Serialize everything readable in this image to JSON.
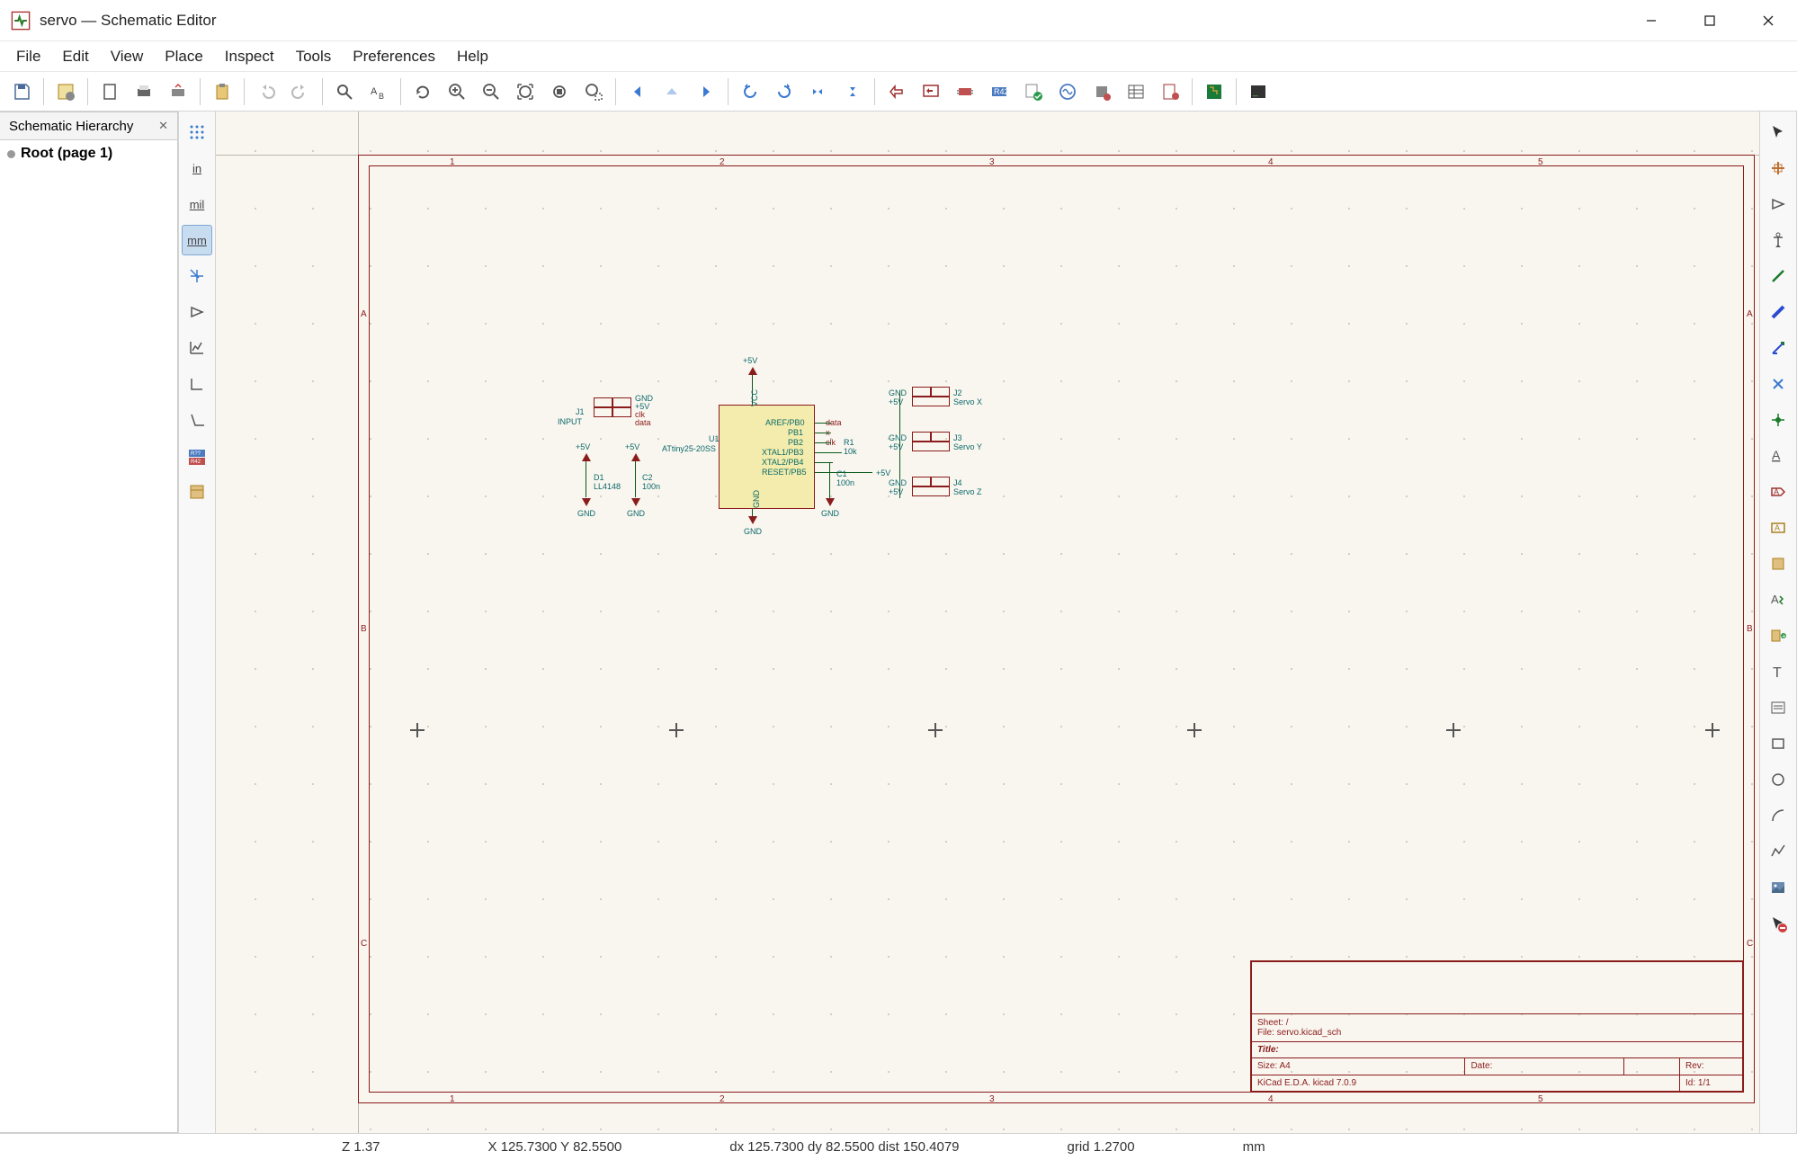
{
  "title": "servo — Schematic Editor",
  "menu": [
    "File",
    "Edit",
    "View",
    "Place",
    "Inspect",
    "Tools",
    "Preferences",
    "Help"
  ],
  "hierarchy": {
    "tab": "Schematic Hierarchy",
    "root": "Root (page 1)"
  },
  "left_icons": [
    "grid-icon",
    "in",
    "mil",
    "mm",
    "cursor-cross",
    "opamp-icon",
    "plot-icon",
    "axes-icon",
    "skew-axes-icon",
    "ref-r42-icon",
    "sheet-icon"
  ],
  "left_active_index": 3,
  "right_icons": [
    "select-icon",
    "highlight-net-icon",
    "opamp-place-icon",
    "power-port-icon",
    "wire-icon",
    "bus-icon",
    "bus-entry-icon",
    "noconnect-icon",
    "junction-icon",
    "local-label-icon",
    "global-label-icon",
    "hier-label-icon",
    "sheet-icon",
    "netclass-icon",
    "sheet-pin-icon",
    "text-letter-icon",
    "textbox-icon",
    "rect-icon",
    "circle-icon",
    "arc-icon",
    "polyline-icon",
    "image-icon",
    "delete-tool-icon"
  ],
  "schematic": {
    "power_labels": {
      "p5v": "+5V",
      "gnd": "GND"
    },
    "connectors": [
      {
        "ref": "J1",
        "name": "INPUT",
        "pins": [
          "GND",
          "+5V",
          "clk",
          "data"
        ]
      },
      {
        "ref": "J2",
        "name": "Servo X"
      },
      {
        "ref": "J3",
        "name": "Servo Y"
      },
      {
        "ref": "J4",
        "name": "Servo Z"
      }
    ],
    "chip": {
      "ref": "U1",
      "type": "ATtiny25-20SS",
      "pins_l": [
        "VCC"
      ],
      "pins_r": [
        "AREF/PB0",
        "PB1",
        "PB2",
        "XTAL1/PB3",
        "XTAL2/PB4",
        "RESET/PB5"
      ],
      "pins_b": [
        "GND"
      ]
    },
    "parts": [
      {
        "ref": "D1",
        "val": "LL4148"
      },
      {
        "ref": "C2",
        "val": "100n"
      },
      {
        "ref": "C1",
        "val": "100n"
      },
      {
        "ref": "R1",
        "val": "10k"
      }
    ],
    "netlabels": [
      "data",
      "clk",
      "x"
    ],
    "titleblock": {
      "sheet": "Sheet: /",
      "file": "File: servo.kicad_sch",
      "title_lbl": "Title:",
      "size": "Size: A4",
      "date": "Date:",
      "rev": "Rev:",
      "gen": "KiCad E.D.A.  kicad 7.0.9",
      "id": "Id: 1/1"
    }
  },
  "status": {
    "z": "Z 1.37",
    "xy": "X 125.7300  Y 82.5500",
    "dxy": "dx 125.7300  dy 82.5500  dist 150.4079",
    "grid": "grid 1.2700",
    "unit": "mm"
  }
}
